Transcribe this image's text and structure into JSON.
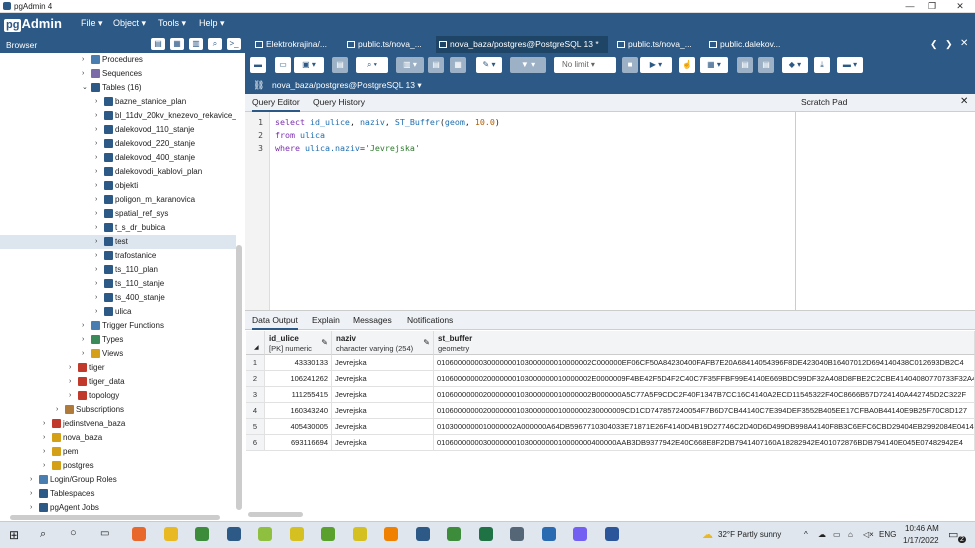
{
  "window": {
    "title": "pgAdmin 4",
    "controls": [
      "—",
      "❐",
      "✕"
    ]
  },
  "menu": {
    "logo": "Admin",
    "logo_prefix": "pg",
    "items": [
      "File ▾",
      "Object ▾",
      "Tools ▾",
      "Help ▾"
    ]
  },
  "browser": {
    "title": "Browser",
    "tree": [
      {
        "label": "Procedures",
        "icon": "procedures-icon",
        "color": "#4a7db0"
      },
      {
        "label": "Sequences",
        "icon": "sequences-icon",
        "color": "#7a6aa8"
      },
      {
        "label": "Tables (16)",
        "icon": "tables-icon",
        "color": "#2c5985"
      },
      {
        "label": "bazne_stanice_plan",
        "icon": "table-icon",
        "color": "#2c5985"
      },
      {
        "label": "bl_11dv_20kv_knezevo_rekavice_",
        "icon": "table-icon",
        "color": "#2c5985"
      },
      {
        "label": "dalekovod_110_stanje",
        "icon": "table-icon",
        "color": "#2c5985"
      },
      {
        "label": "dalekovod_220_stanje",
        "icon": "table-icon",
        "color": "#2c5985"
      },
      {
        "label": "dalekovod_400_stanje",
        "icon": "table-icon",
        "color": "#2c5985"
      },
      {
        "label": "dalekovodi_kablovi_plan",
        "icon": "table-icon",
        "color": "#2c5985"
      },
      {
        "label": "objekti",
        "icon": "table-icon",
        "color": "#2c5985"
      },
      {
        "label": "poligon_m_karanovica",
        "icon": "table-icon",
        "color": "#2c5985"
      },
      {
        "label": "spatial_ref_sys",
        "icon": "table-icon",
        "color": "#2c5985"
      },
      {
        "label": "t_s_dr_bubica",
        "icon": "table-icon",
        "color": "#2c5985"
      },
      {
        "label": "test",
        "icon": "table-icon",
        "color": "#2c5985"
      },
      {
        "label": "trafostanice",
        "icon": "table-icon",
        "color": "#2c5985"
      },
      {
        "label": "ts_110_plan",
        "icon": "table-icon",
        "color": "#2c5985"
      },
      {
        "label": "ts_110_stanje",
        "icon": "table-icon",
        "color": "#2c5985"
      },
      {
        "label": "ts_400_stanje",
        "icon": "table-icon",
        "color": "#2c5985"
      },
      {
        "label": "ulica",
        "icon": "table-icon",
        "color": "#2c5985"
      },
      {
        "label": "Trigger Functions",
        "icon": "trigger-functions-icon",
        "color": "#4a7db0"
      },
      {
        "label": "Types",
        "icon": "types-icon",
        "color": "#3a8a5a"
      },
      {
        "label": "Views",
        "icon": "views-icon",
        "color": "#d4a017"
      },
      {
        "label": "tiger",
        "icon": "schema-icon",
        "color": "#c0392b"
      },
      {
        "label": "tiger_data",
        "icon": "schema-icon",
        "color": "#c0392b"
      },
      {
        "label": "topology",
        "icon": "schema-icon",
        "color": "#c0392b"
      },
      {
        "label": "Subscriptions",
        "icon": "subscriptions-icon",
        "color": "#b07a3a"
      },
      {
        "label": "jedinstvena_baza",
        "icon": "database-icon",
        "color": "#c0392b"
      },
      {
        "label": "nova_baza",
        "icon": "database-icon",
        "color": "#d4a017"
      },
      {
        "label": "pem",
        "icon": "database-icon",
        "color": "#d4a017"
      },
      {
        "label": "postgres",
        "icon": "database-icon",
        "color": "#d4a017"
      },
      {
        "label": "Login/Group Roles",
        "icon": "roles-icon",
        "color": "#4a7db0"
      },
      {
        "label": "Tablespaces",
        "icon": "tablespaces-icon",
        "color": "#2c5985"
      },
      {
        "label": "pgAgent Jobs",
        "icon": "pgagent-icon",
        "color": "#2c5985"
      }
    ]
  },
  "tabs": [
    {
      "label": "Elektrokrajina/..."
    },
    {
      "label": "public.ts/nova_..."
    },
    {
      "label": "nova_baza/postgres@PostgreSQL 13 *"
    },
    {
      "label": "public.ts/nova_..."
    },
    {
      "label": "public.dalekov..."
    }
  ],
  "toolbar": {
    "limit": "No limit"
  },
  "connection": {
    "label": "nova_baza/postgres@PostgreSQL 13 ▾"
  },
  "editor": {
    "tabs": [
      "Query Editor",
      "Query History"
    ],
    "scratch_pad": "Scratch Pad",
    "line_numbers": [
      "1",
      "2",
      "3"
    ],
    "lines": [
      [
        {
          "t": "select ",
          "c": "kw"
        },
        {
          "t": "id_ulice",
          "c": "fn"
        },
        {
          "t": ", ",
          "c": ""
        },
        {
          "t": "naziv",
          "c": "fn"
        },
        {
          "t": ", ",
          "c": ""
        },
        {
          "t": "ST_Buffer",
          "c": "fn"
        },
        {
          "t": "(",
          "c": ""
        },
        {
          "t": "geom",
          "c": "fn"
        },
        {
          "t": ", ",
          "c": ""
        },
        {
          "t": "10.0",
          "c": "num"
        },
        {
          "t": ")",
          "c": ""
        }
      ],
      [
        {
          "t": "from ",
          "c": "kw"
        },
        {
          "t": "ulica",
          "c": "fn"
        }
      ],
      [
        {
          "t": "where ",
          "c": "kw"
        },
        {
          "t": "ulica.naziv",
          "c": "fn"
        },
        {
          "t": "=",
          "c": ""
        },
        {
          "t": "'Jevrejska'",
          "c": "str"
        }
      ]
    ]
  },
  "results": {
    "tabs": [
      "Data Output",
      "Explain",
      "Messages",
      "Notifications"
    ],
    "columns": [
      {
        "name": "id_ulice",
        "type": "[PK] numeric"
      },
      {
        "name": "naziv",
        "type": "character varying (254)"
      },
      {
        "name": "st_buffer",
        "type": "geometry"
      }
    ],
    "rows": [
      [
        "1",
        "43330133",
        "Jevrejska",
        "0106000000030000000103000000010000002C000000EF06CF50A84230400FAFB7E20A68414054396F8DE423040B16407012D694140438C012693DB2C4"
      ],
      [
        "2",
        "106241262",
        "Jevrejska",
        "0106000000020000000103000000010000002E0000009F4BE42F5D4F2C40C7F35FFBF99E4140E669BDC99DF32A408D8FBE2C2CBE41404080770733F32A4"
      ],
      [
        "3",
        "111255415",
        "Jevrejska",
        "0106000000020000000103000000010000002B000000A5C77A5F9CDC2F40F1347B7CC16C4140A2ECD11545322F40C8666B57D724140A442745D2C322F"
      ],
      [
        "4",
        "160343240",
        "Jevrejska",
        "010600000002000000010300000001000000230000009CD1CD747857240054F7B6D7CB44140C7E394DEF3552B405EE17CFBA0B44140E9B25F70C8D127"
      ],
      [
        "5",
        "405430005",
        "Jevrejska",
        "0103000000010000002A000000A64DB5967710304033E71871E26F4140D4B19D27746C2D40D6D499DB998A4140F8B3C6EFC6CBD29404EB2992084E041407"
      ],
      [
        "6",
        "693116694",
        "Jevrejska",
        "0106000000030000000103000000010000000400000AAB3DB9377942E40C668E8F2DB7941407160A18282942E401072876BDB794140E045E07482942E4"
      ]
    ]
  },
  "taskbar": {
    "weather": "32°F  Partly sunny",
    "lang": "ENG",
    "time": "10:46 AM",
    "date": "1/17/2022",
    "notif_count": "2",
    "apps": [
      {
        "name": "firefox-icon",
        "color": "#e8672a"
      },
      {
        "name": "file-explorer-icon",
        "color": "#e8b923"
      },
      {
        "name": "chrome-icon",
        "color": "#3c8c3c"
      },
      {
        "name": "pgadmin-icon",
        "color": "#2c5985"
      },
      {
        "name": "qgis-icon",
        "color": "#8fbf3f"
      },
      {
        "name": "qgis-icon-2",
        "color": "#d4c020"
      },
      {
        "name": "qgis-icon-3",
        "color": "#5aa02c"
      },
      {
        "name": "qgis-icon-4",
        "color": "#d4c020"
      },
      {
        "name": "vlc-icon",
        "color": "#f08000"
      },
      {
        "name": "pgadmin-icon-active",
        "color": "#2c5985"
      },
      {
        "name": "notepad-icon",
        "color": "#3c8c3c"
      },
      {
        "name": "excel-icon",
        "color": "#1f7244"
      },
      {
        "name": "app-icon",
        "color": "#556677"
      },
      {
        "name": "edge-icon",
        "color": "#2a6ab0"
      },
      {
        "name": "viber-icon",
        "color": "#7360f2"
      },
      {
        "name": "word-icon",
        "color": "#2b579a"
      }
    ]
  }
}
